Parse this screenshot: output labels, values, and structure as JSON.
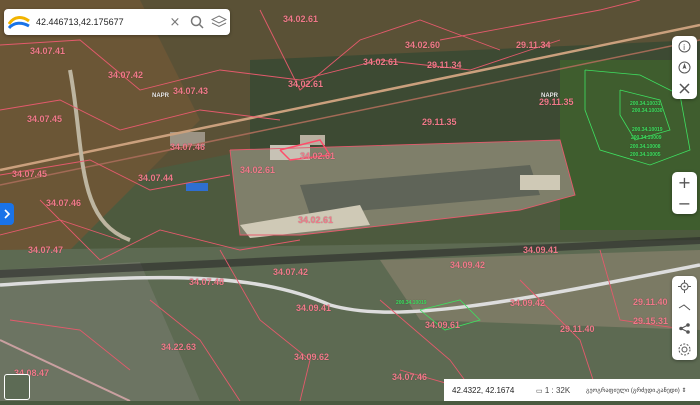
{
  "search": {
    "value": "42.446713,42.175677"
  },
  "status": {
    "coords": "42.4322, 42.1674",
    "scale_icon": "ruler-icon",
    "scale": "1 : 32K",
    "projection": "გეოგრაფიული (გრძედი,განედი)"
  },
  "labels": [
    "34.02.61",
    "34.02.60",
    "29.11.34",
    "34.07.41",
    "34.07.42",
    "34.07.43",
    "NAPR",
    "34.02.61",
    "29.11.34",
    "34.02.61",
    "NAPR",
    "29.11.35",
    "34.07.45",
    "29.11.35",
    "34.07.46",
    "34.02.61",
    "34.07.45",
    "34.07.44",
    "34.07.46",
    "34.07.47",
    "34.02.61",
    "34.02.61",
    "34.07.42",
    "34.09.41",
    "34.07.48",
    "34.09.42",
    "29.11.40",
    "34.22.63",
    "34.09.41",
    "34.09.61",
    "29.11.40",
    "29.15.31",
    "34.09.62",
    "34.08.47",
    "34.07.46",
    "34.09.42"
  ],
  "green_labels": [
    "200.34.10031",
    "200.34.10030",
    "200.34.10019",
    "200.34.10009",
    "200.34.10008",
    "200.34.10005",
    "200.34.10019"
  ],
  "colors": {
    "parcel": "#f07a8a",
    "accent": "#1a73e8",
    "green_parcel": "#3ee060"
  }
}
